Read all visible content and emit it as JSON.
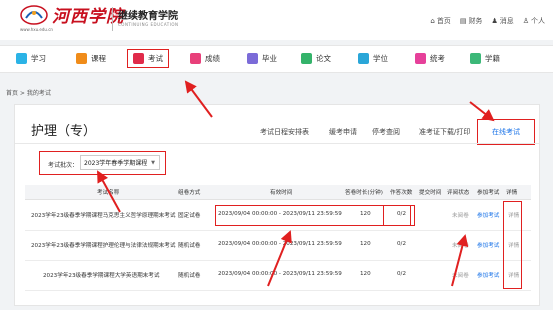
{
  "header": {
    "logo_text": "河西学院",
    "logo_url": "www.hxu.edu.cn",
    "title": "继续教育学院",
    "subtitle": "CONTINUING EDUCATION",
    "links": [
      {
        "icon": "home-icon",
        "label": "首页"
      },
      {
        "icon": "wallet-icon",
        "label": "财务"
      },
      {
        "icon": "bell-icon",
        "label": "消息"
      },
      {
        "icon": "user-icon",
        "label": "个人"
      }
    ]
  },
  "nav": [
    {
      "label": "学习",
      "color": "#2bb3e6"
    },
    {
      "label": "课程",
      "color": "#f08c1a"
    },
    {
      "label": "考试",
      "color": "#e02b4a"
    },
    {
      "label": "成绩",
      "color": "#e8407a"
    },
    {
      "label": "毕业",
      "color": "#7b6bd8"
    },
    {
      "label": "论文",
      "color": "#34b36a"
    },
    {
      "label": "学位",
      "color": "#2aa6d8"
    },
    {
      "label": "统考",
      "color": "#e6409a"
    },
    {
      "label": "学籍",
      "color": "#3cb878"
    }
  ],
  "breadcrumb": "首页 > 我的考试",
  "page": {
    "title": "护理（专）",
    "tabs": [
      "考试日程安排表",
      "缓考申请",
      "停考查阅",
      "准考证下载/打印"
    ],
    "active_tab": "在线考试"
  },
  "filter": {
    "label": "考试批次：",
    "value": "2023学年春季学期课程"
  },
  "table": {
    "headers": [
      "考试名称",
      "组卷方式",
      "有效时间",
      "答卷时长(分钟)",
      "作答次数",
      "提交时间",
      "评阅状态",
      "参加考试",
      "详情"
    ],
    "rows": [
      {
        "name": "2023学年23级春季学期课程马克思主义哲学原理期末考试",
        "method": "固定试卷",
        "time": "2023/09/04 00:00:00 - 2023/09/11 23:59:59",
        "duration": "120",
        "attempts": "0/2",
        "submit": "",
        "status": "未阅卷",
        "join": "参加考试",
        "detail": "详情"
      },
      {
        "name": "2023学年23级春季学期课程护理伦理与法律法规期末考试",
        "method": "随机试卷",
        "time": "2023/09/04 00:00:00 - 2023/09/11 23:59:59",
        "duration": "120",
        "attempts": "0/2",
        "submit": "",
        "status": "未阅卷",
        "join": "参加考试",
        "detail": "详情"
      },
      {
        "name": "2023学年23级春季学期课程大学英语期末考试",
        "method": "随机试卷",
        "time": "2023/09/04 00:00:00 - 2023/09/11 23:59:59",
        "duration": "120",
        "attempts": "0/2",
        "submit": "",
        "status": "未阅卷",
        "join": "参加考试",
        "detail": "详情"
      }
    ]
  },
  "colors": {
    "accent": "#1a73e8",
    "highlight": "#e02020",
    "brand_red": "#c8101f"
  }
}
